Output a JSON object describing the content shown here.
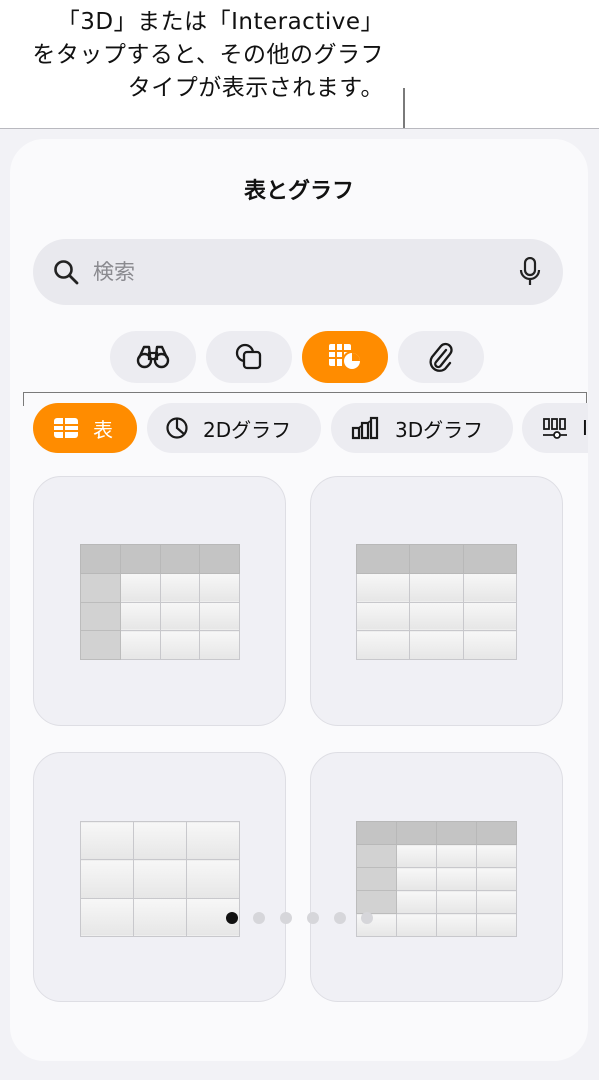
{
  "callout": {
    "line1": "「3D」または「Interactive」",
    "line2": "をタップすると、その他のグラフ",
    "line3": "タイプが表示されます。"
  },
  "sheet": {
    "title": "表とグラフ"
  },
  "search": {
    "placeholder": "検索",
    "value": ""
  },
  "categories": [
    {
      "icon": "binoculars-icon",
      "active": false
    },
    {
      "icon": "shapes-icon",
      "active": false
    },
    {
      "icon": "table-chart-icon",
      "active": true
    },
    {
      "icon": "paperclip-icon",
      "active": false
    }
  ],
  "chips": [
    {
      "label": "表",
      "icon": "table-icon",
      "active": true
    },
    {
      "label": "2Dグラフ",
      "icon": "pie-chart-icon",
      "active": false
    },
    {
      "label": "3Dグラフ",
      "icon": "bar-chart-3d-icon",
      "active": false
    },
    {
      "label": "I",
      "icon": "slider-chart-icon",
      "active": false
    }
  ],
  "templates": [
    {
      "style": "header-row-and-column"
    },
    {
      "style": "header-row"
    },
    {
      "style": "basic"
    },
    {
      "style": "header-row-column-footer"
    }
  ],
  "pagination": {
    "count": 6,
    "current": 1
  },
  "colors": {
    "accent": "#ff8c00",
    "chip_bg": "#ececf1",
    "sheet_bg": "#fafafc"
  }
}
